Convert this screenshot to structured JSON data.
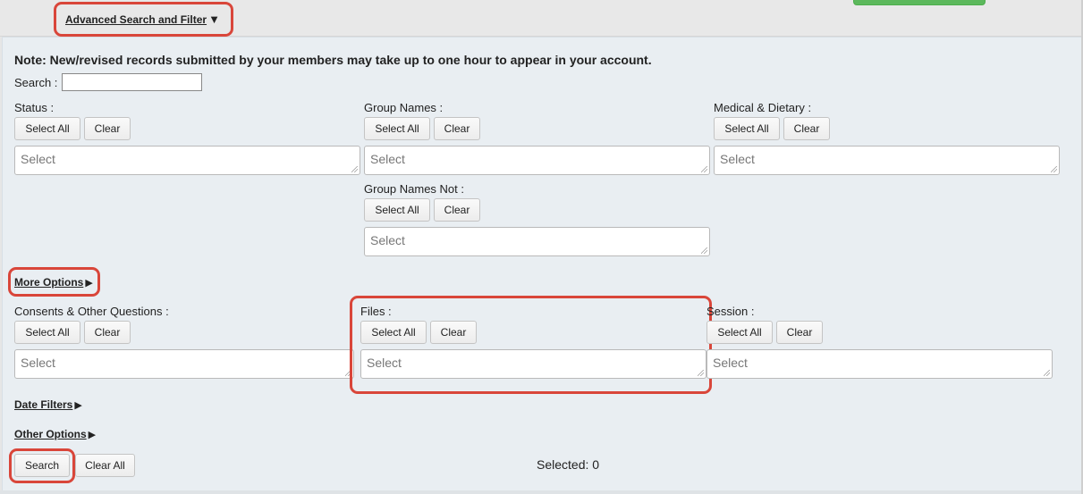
{
  "header": {
    "advanced_toggle": "Advanced Search and Filter",
    "advanced_arrow": "▼"
  },
  "note": "Note: New/revised records submitted by your members may take up to one hour to appear in your account.",
  "search": {
    "label": "Search :",
    "value": ""
  },
  "filters": {
    "status": {
      "label": "Status :",
      "select_all": "Select All",
      "clear": "Clear",
      "placeholder": "Select"
    },
    "group_names": {
      "label": "Group Names :",
      "select_all": "Select All",
      "clear": "Clear",
      "placeholder": "Select"
    },
    "medical": {
      "label": "Medical & Dietary :",
      "select_all": "Select All",
      "clear": "Clear",
      "placeholder": "Select"
    },
    "group_names_not": {
      "label": "Group Names Not :",
      "select_all": "Select All",
      "clear": "Clear",
      "placeholder": "Select"
    },
    "consents": {
      "label": "Consents & Other Questions :",
      "select_all": "Select All",
      "clear": "Clear",
      "placeholder": "Select"
    },
    "files": {
      "label": "Files :",
      "select_all": "Select All",
      "clear": "Clear",
      "placeholder": "Select"
    },
    "session": {
      "label": "Session :",
      "select_all": "Select All",
      "clear": "Clear",
      "placeholder": "Select"
    }
  },
  "toggles": {
    "more_options": "More Options",
    "date_filters": "Date Filters",
    "other_options": "Other Options",
    "collapsed_arrow": "▶"
  },
  "actions": {
    "search": "Search",
    "clear_all": "Clear All"
  },
  "selected_text": "Selected: 0",
  "colors": {
    "highlight": "#d9463a",
    "green_button": "#5cb85c",
    "panel_bg": "#e9eef2"
  }
}
